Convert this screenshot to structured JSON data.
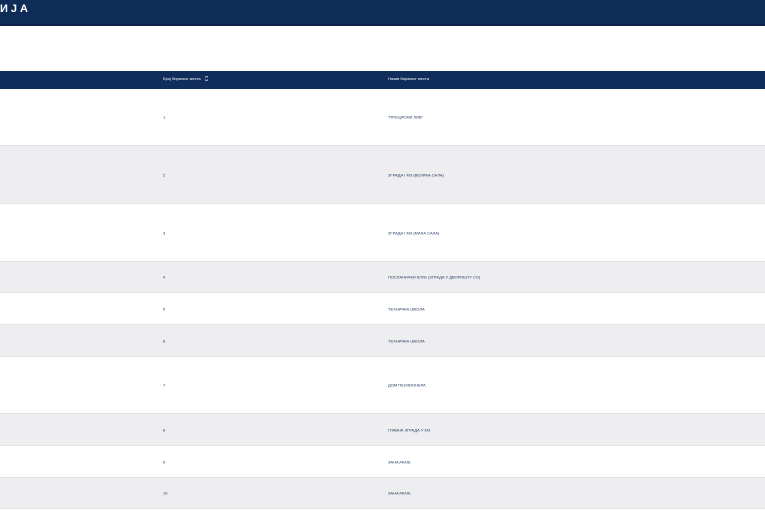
{
  "header": {
    "title": "ИЈА"
  },
  "table": {
    "columns": {
      "number": "Број бирачког места",
      "name": "Назив бирачког места"
    },
    "rows": [
      {
        "number": "1",
        "name": "\"ПРЕЦИОНИ ЛИВ\""
      },
      {
        "number": "2",
        "name": "ЗГРАДА I МЗ (ВЕЛИКА САЛА)"
      },
      {
        "number": "3",
        "name": "ЗГРАДА I МЗ (МАЛА САЛА)"
      },
      {
        "number": "4",
        "name": "ПОСЛАНИЧКИ КЛУБ (ЗГРАДА У ДВОРИШТУ СО)"
      },
      {
        "number": "5",
        "name": "ТЕХНИЧКА ШКОЛА"
      },
      {
        "number": "6",
        "name": "ТЕХНИЧКА ШКОЛА"
      },
      {
        "number": "7",
        "name": "ДОМ ПЕНЗИОНЕРА"
      },
      {
        "number": "8",
        "name": "ГЛАВНА ЗГРАДА У МЗ"
      },
      {
        "number": "9",
        "name": "ЗАНАЈЧИЈЕ"
      },
      {
        "number": "10",
        "name": "ЗАНАЈЧИЈЕ"
      }
    ]
  }
}
